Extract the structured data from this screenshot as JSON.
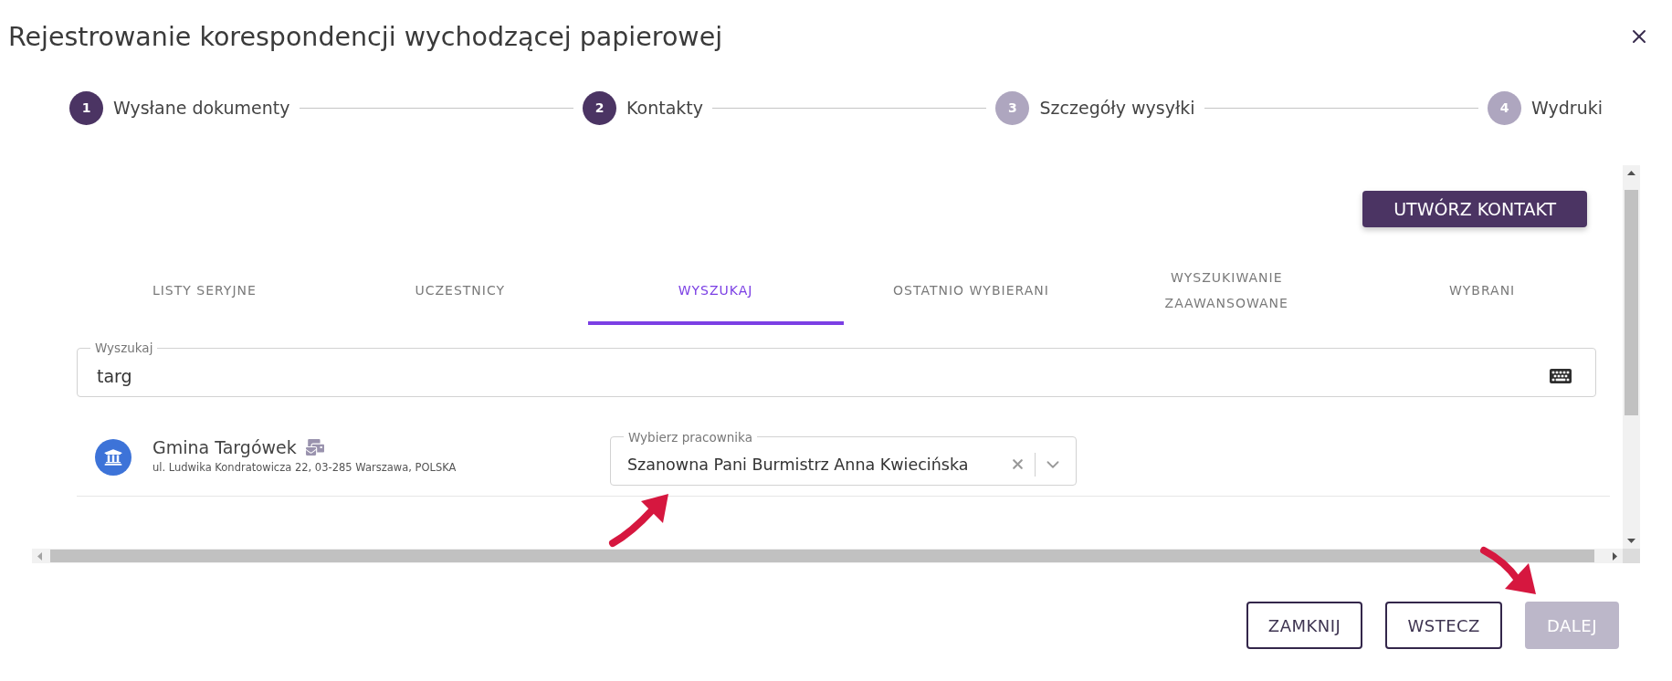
{
  "window": {
    "title": "Rejestrowanie korespondencji wychodzącej papierowej"
  },
  "steps": [
    {
      "number": "1",
      "label": "Wysłane dokumenty",
      "active": true
    },
    {
      "number": "2",
      "label": "Kontakty",
      "active": true
    },
    {
      "number": "3",
      "label": "Szczegóły wysyłki",
      "active": false
    },
    {
      "number": "4",
      "label": "Wydruki",
      "active": false
    }
  ],
  "create_contact_button": {
    "label": "UTWÓRZ KONTAKT"
  },
  "tabs": [
    {
      "label": "LISTY SERYJNE",
      "selected": false
    },
    {
      "label": "UCZESTNICY",
      "selected": false
    },
    {
      "label": "WYSZUKAJ",
      "selected": true
    },
    {
      "label": "OSTATNIO WYBIERANI",
      "selected": false
    },
    {
      "label": "WYSZUKIWANIE ZAAWANSOWANE",
      "selected": false
    },
    {
      "label": "WYBRANI",
      "selected": false
    }
  ],
  "search": {
    "label": "Wyszukaj",
    "value": "targ"
  },
  "results": [
    {
      "name": "Gmina Targówek",
      "address": "ul. Ludwika Kondratowicza 22, 03-285 Warszawa, POLSKA",
      "employee_select": {
        "label": "Wybierz pracownika",
        "value": "Szanowna Pani Burmistrz Anna Kwiecińska"
      }
    }
  ],
  "buttons": [
    {
      "label": "ZAMKNIJ",
      "kind": "outlined",
      "disabled": false
    },
    {
      "label": "WSTECZ",
      "kind": "outlined",
      "disabled": false
    },
    {
      "label": "DALEJ",
      "kind": "primary",
      "disabled": true
    }
  ]
}
